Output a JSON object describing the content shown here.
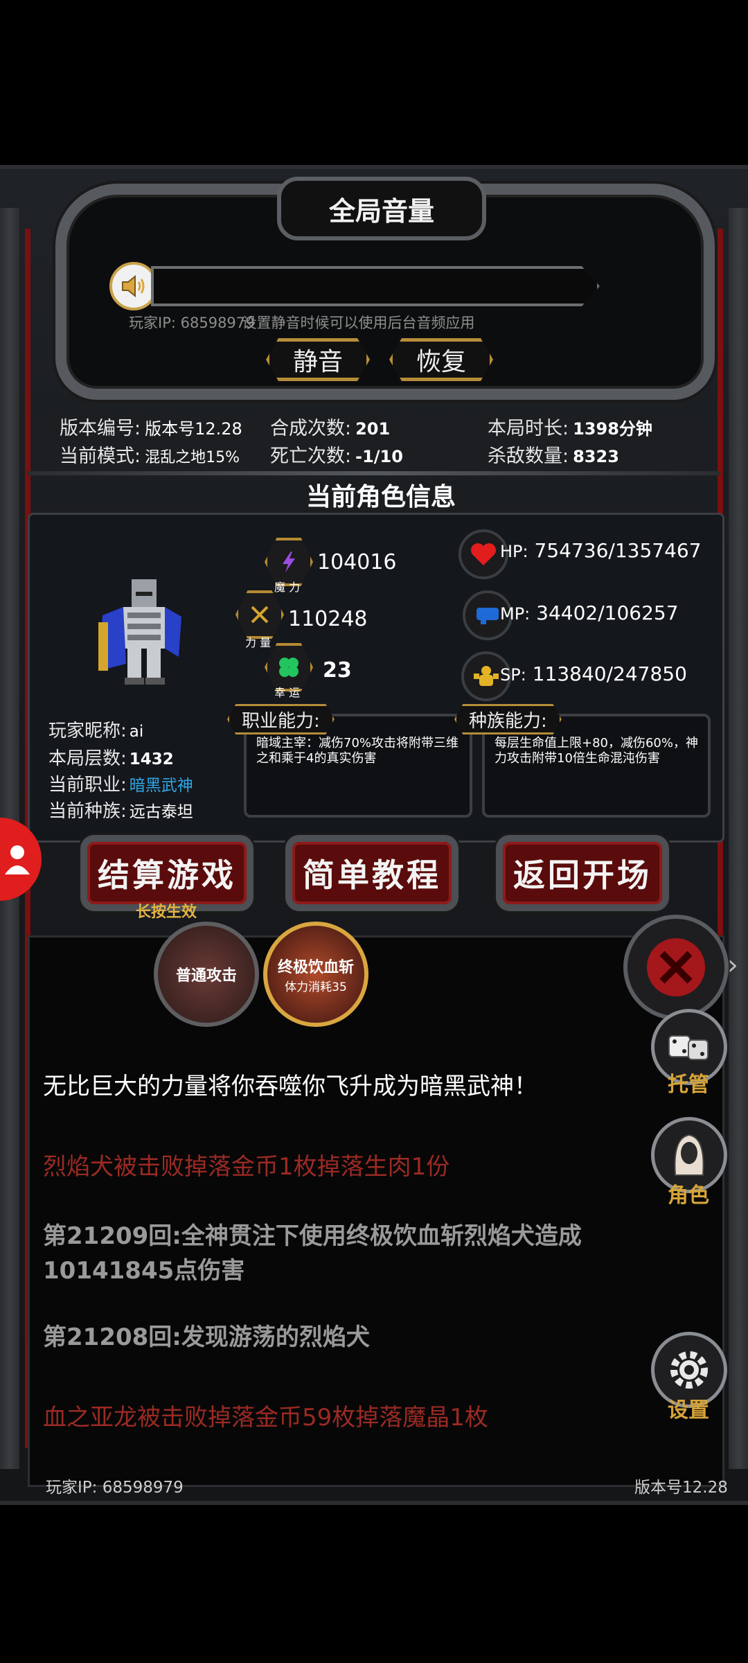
{
  "volume": {
    "title": "全局音量",
    "ip_hint_prefix": "玩家IP:",
    "ip": "68598979",
    "hint": "设置静音时候可以使用后台音频应用",
    "mute_label": "静音",
    "restore_label": "恢复"
  },
  "stats": {
    "version_label": "版本编号:",
    "version": "版本号12.28",
    "mode_label": "当前模式:",
    "mode": "混乱之地15%",
    "craft_label": "合成次数:",
    "craft": "201",
    "death_label": "死亡次数:",
    "death": "-1/10",
    "time_label": "本局时长:",
    "time": "1398分钟",
    "kills_label": "杀敌数量:",
    "kills": "8323"
  },
  "character": {
    "section_title": "当前角色信息",
    "magic": "104016",
    "magic_label": "魔 力",
    "strength": "110248",
    "strength_label": "力 量",
    "luck": "23",
    "luck_label": "幸 运",
    "hp_label": "HP:",
    "hp": "754736/1357467",
    "mp_label": "MP:",
    "mp": "34402/106257",
    "sp_label": "SP:",
    "sp": "113840/247850",
    "nickname_label": "玩家昵称:",
    "nickname": "ai",
    "floor_label": "本局层数:",
    "floor": "1432",
    "class_label": "当前职业:",
    "class": "暗黑武神",
    "race_label": "当前种族:",
    "race": "远古泰坦",
    "class_ability_label": "职业能力:",
    "class_ability": "暗域主宰：减伤70%攻击将附带三维之和乘于4的真实伤害",
    "race_ability_label": "种族能力:",
    "race_ability": "每层生命值上限+80，减伤60%，神力攻击附带10倍生命混沌伤害"
  },
  "buttons": {
    "settle": "结算游戏",
    "settle_hint": "长按生效",
    "tutorial": "简单教程",
    "back": "返回开场"
  },
  "skills": {
    "normal_attack": "普通攻击",
    "ultimate": "终极饮血斩",
    "ultimate_cost": "体力消耗35"
  },
  "side": {
    "auto": "托管",
    "role": "角色",
    "settings": "设置"
  },
  "log": [
    {
      "text": "无比巨大的力量将你吞噬你飞升成为暗黑武神！",
      "color": "#ffffff"
    },
    {
      "text": "烈焰犬被击败掉落金币1枚掉落生肉1份",
      "color": "#9b2a24"
    },
    {
      "text": "第21209回:全神贯注下使用终极饮血斩烈焰犬造成",
      "color": "#9a9a9a"
    },
    {
      "text": "10141845点伤害",
      "color": "#9a9a9a"
    },
    {
      "text": "第21208回:发现游荡的烈焰犬",
      "color": "#9a9a9a"
    },
    {
      "text": "血之亚龙被击败掉落金币59枚掉落魔晶1枚",
      "color": "#9b2a24"
    }
  ],
  "footer": {
    "ip_label": "玩家IP:",
    "ip": "68598979",
    "version": "版本号12.28"
  },
  "colors": {
    "accent_gold": "#b68d3a",
    "class_blue": "#2fa7e8",
    "button_red": "#5a0b0b"
  }
}
